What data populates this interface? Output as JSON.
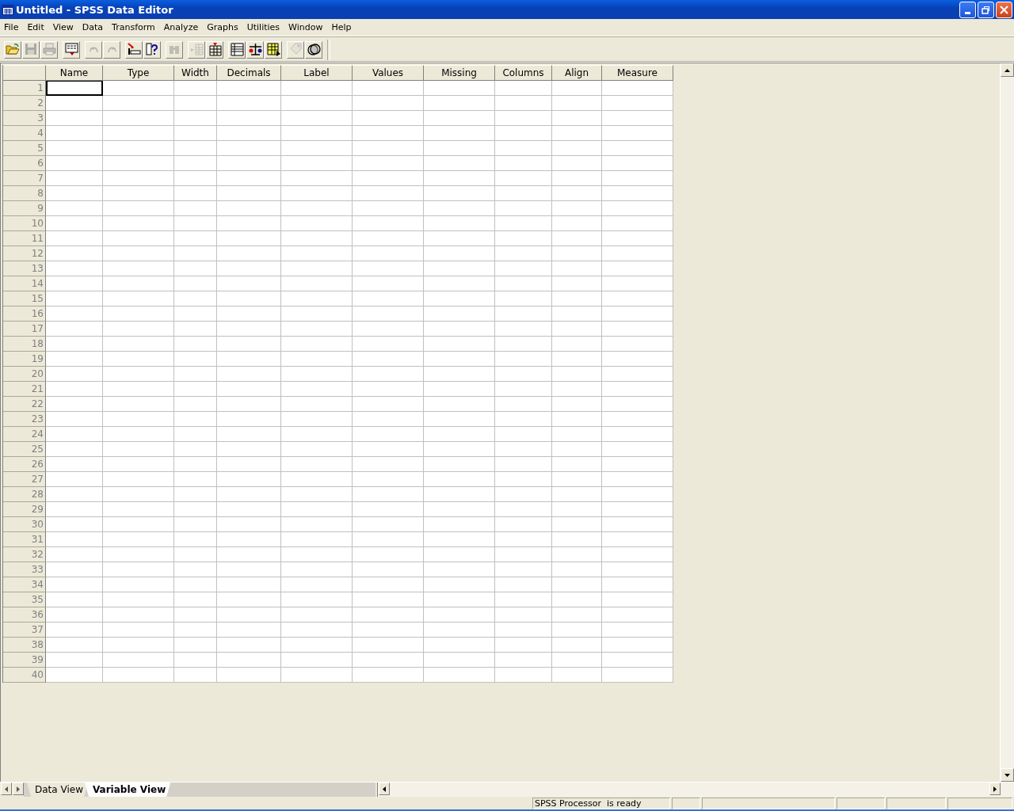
{
  "window": {
    "title": "Untitled - SPSS Data Editor"
  },
  "menu": [
    "File",
    "Edit",
    "View",
    "Data",
    "Transform",
    "Analyze",
    "Graphs",
    "Utilities",
    "Window",
    "Help"
  ],
  "toolbar": {
    "groups": [
      {
        "buttons": [
          {
            "kind": "open",
            "disabled": false
          },
          {
            "kind": "save",
            "disabled": true
          },
          {
            "kind": "print",
            "disabled": true
          }
        ]
      },
      {
        "buttons": [
          {
            "kind": "recall",
            "disabled": false
          }
        ]
      },
      {
        "buttons": [
          {
            "kind": "undo",
            "disabled": true
          },
          {
            "kind": "redo",
            "disabled": true
          }
        ]
      },
      {
        "buttons": [
          {
            "kind": "goto",
            "disabled": false
          },
          {
            "kind": "variables",
            "disabled": false
          }
        ]
      },
      {
        "buttons": [
          {
            "kind": "find",
            "disabled": true
          }
        ]
      },
      {
        "buttons": [
          {
            "kind": "insertcase",
            "disabled": true
          },
          {
            "kind": "insertvar",
            "disabled": false
          }
        ]
      },
      {
        "buttons": [
          {
            "kind": "split",
            "disabled": false
          },
          {
            "kind": "weight",
            "disabled": false
          },
          {
            "kind": "select",
            "disabled": false
          }
        ]
      },
      {
        "buttons": [
          {
            "kind": "labels",
            "disabled": true
          },
          {
            "kind": "sets",
            "disabled": false
          }
        ]
      }
    ]
  },
  "table": {
    "columns": [
      "Name",
      "Type",
      "Width",
      "Decimals",
      "Label",
      "Values",
      "Missing",
      "Columns",
      "Align",
      "Measure"
    ],
    "rows": [
      {
        "number": "1",
        "selected": true
      },
      {
        "number": "2",
        "selected": false
      },
      {
        "number": "3",
        "selected": false
      },
      {
        "number": "4",
        "selected": false
      },
      {
        "number": "5",
        "selected": false
      },
      {
        "number": "6",
        "selected": false
      },
      {
        "number": "7",
        "selected": false
      },
      {
        "number": "8",
        "selected": false
      },
      {
        "number": "9",
        "selected": false
      },
      {
        "number": "10",
        "selected": false
      },
      {
        "number": "11",
        "selected": false
      },
      {
        "number": "12",
        "selected": false
      },
      {
        "number": "13",
        "selected": false
      },
      {
        "number": "14",
        "selected": false
      },
      {
        "number": "15",
        "selected": false
      },
      {
        "number": "16",
        "selected": false
      },
      {
        "number": "17",
        "selected": false
      },
      {
        "number": "18",
        "selected": false
      },
      {
        "number": "19",
        "selected": false
      },
      {
        "number": "20",
        "selected": false
      },
      {
        "number": "21",
        "selected": false
      },
      {
        "number": "22",
        "selected": false
      },
      {
        "number": "23",
        "selected": false
      },
      {
        "number": "24",
        "selected": false
      },
      {
        "number": "25",
        "selected": false
      },
      {
        "number": "26",
        "selected": false
      },
      {
        "number": "27",
        "selected": false
      },
      {
        "number": "28",
        "selected": false
      },
      {
        "number": "29",
        "selected": false
      },
      {
        "number": "30",
        "selected": false
      },
      {
        "number": "31",
        "selected": false
      },
      {
        "number": "32",
        "selected": false
      },
      {
        "number": "33",
        "selected": false
      },
      {
        "number": "34",
        "selected": false
      },
      {
        "number": "35",
        "selected": false
      },
      {
        "number": "36",
        "selected": false
      },
      {
        "number": "37",
        "selected": false
      },
      {
        "number": "38",
        "selected": false
      },
      {
        "number": "39",
        "selected": false
      },
      {
        "number": "40",
        "selected": false
      }
    ]
  },
  "sheet_tabs": [
    {
      "label": "Data View",
      "selected": false
    },
    {
      "label": "Variable View",
      "selected": true
    }
  ],
  "status_bar": {
    "message": "SPSS Processor  is ready"
  }
}
